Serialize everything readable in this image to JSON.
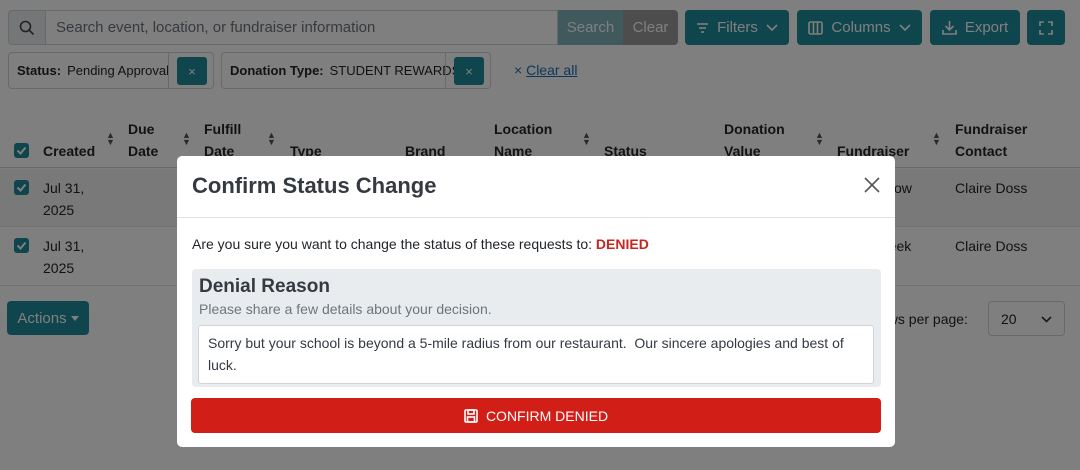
{
  "toolbar": {
    "search_placeholder": "Search event, location, or fundraiser information",
    "search_label": "Search",
    "clear_label": "Clear",
    "filters_label": "Filters",
    "columns_label": "Columns",
    "export_label": "Export"
  },
  "filters": {
    "status": {
      "key": "Status:",
      "value": "Pending Approval",
      "remove": "×"
    },
    "donation_type": {
      "key": "Donation Type:",
      "value": "STUDENT REWARDS",
      "remove": "×"
    },
    "clear_all_icon": "×",
    "clear_all": "Clear all"
  },
  "table": {
    "headers": {
      "created": "Created",
      "due_date_1": "Due",
      "due_date_2": "Date",
      "fulfill_1": "Fulfill",
      "fulfill_2": "Date",
      "type": "Type",
      "brand": "Brand",
      "location_1": "Location",
      "location_2": "Name",
      "status": "Status",
      "donation_1": "Donation",
      "donation_2": "Value",
      "fundraiser": "Fundraiser",
      "contact_1": "Fundraiser",
      "contact_2": "Contact"
    },
    "rows": [
      {
        "created_1": "Jul 31,",
        "created_2": "2025",
        "fundraiser_partial": "ollow",
        "contact": "Claire Doss"
      },
      {
        "created_1": "Jul 31,",
        "created_2": "2025",
        "fundraiser_partial": "reek",
        "contact": "Claire Doss"
      }
    ]
  },
  "footer": {
    "actions_label": "Actions",
    "rows_per_page_label": "ows per page:",
    "rows_per_page_value": "20"
  },
  "modal": {
    "title": "Confirm Status Change",
    "question": "Are you sure you want to change the status of these requests to:",
    "status_value": "DENIED",
    "reason_title": "Denial Reason",
    "reason_help": "Please share a few details about your decision.",
    "reason_text": "Sorry but your school is beyond a 5-mile radius from our restaurant.  Our sincere apologies and best of luck.",
    "confirm_label": "CONFIRM DENIED"
  }
}
